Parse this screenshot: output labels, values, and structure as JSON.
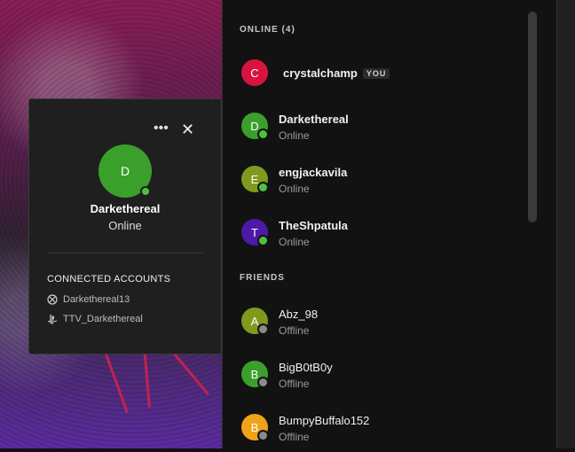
{
  "sections": {
    "online_title": "ONLINE (4)",
    "friends_title": "FRIENDS"
  },
  "online": [
    {
      "initial": "C",
      "name": "crystalchamp",
      "badge": "YOU",
      "status": "",
      "color": "#d7143f",
      "status_color": ""
    },
    {
      "initial": "D",
      "name": "Darkethereal",
      "status": "Online",
      "color": "#3aa02b",
      "status_color": "#4fc140"
    },
    {
      "initial": "E",
      "name": "engjackavila",
      "status": "Online",
      "color": "#7f9a1d",
      "status_color": "#4fc140"
    },
    {
      "initial": "T",
      "name": "TheShpatula",
      "status": "Online",
      "color": "#4c1aa4",
      "status_color": "#4fc140"
    }
  ],
  "friends": [
    {
      "initial": "A",
      "name": "Abz_98",
      "status": "Offline",
      "color": "#7f9a1d",
      "status_color": "#8a8a8a"
    },
    {
      "initial": "B",
      "name": "BigB0tB0y",
      "status": "Offline",
      "color": "#3aa02b",
      "status_color": "#8a8a8a"
    },
    {
      "initial": "B",
      "name": "BumpyBuffalo152",
      "status": "Offline",
      "color": "#f0a31a",
      "status_color": "#8a8a8a"
    }
  ],
  "popup": {
    "more_icon": "•••",
    "close_icon": "✕",
    "initial": "D",
    "name": "Darkethereal",
    "status": "Online",
    "connected_title": "CONNECTED ACCOUNTS",
    "accounts": [
      {
        "icon": "xbox-icon",
        "label": "Darkethereal13"
      },
      {
        "icon": "playstation-icon",
        "label": "TTV_Darkethereal"
      }
    ]
  }
}
